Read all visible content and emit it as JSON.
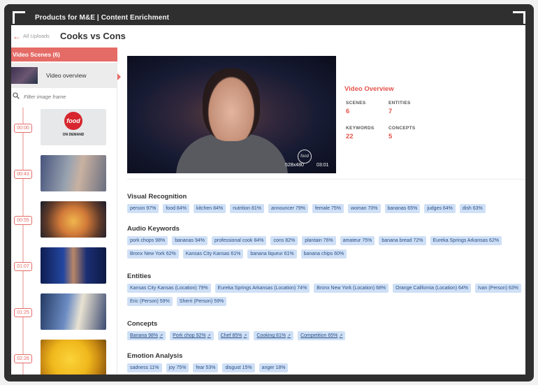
{
  "app": {
    "title": "Products for M&E | Content Enrichment"
  },
  "header": {
    "back_label": "All Uploads",
    "title": "Cooks vs Cons"
  },
  "sidebar": {
    "scenes_label": "Video Scenes (6)",
    "overview_label": "Video overview",
    "filter_placeholder": "Filter image frame",
    "scenes": [
      {
        "time": "00:00",
        "logo_text": "food",
        "logo_sub": "ON DEMAND"
      },
      {
        "time": "00:43"
      },
      {
        "time": "00:55"
      },
      {
        "time": "01:07"
      },
      {
        "time": "01:25"
      },
      {
        "time": "02:26"
      }
    ]
  },
  "video": {
    "logo_text": "food",
    "resolution": "528x480",
    "duration": "03:01"
  },
  "overview": {
    "title": "Video Overview",
    "stats": [
      {
        "label": "SCENES",
        "value": "6"
      },
      {
        "label": "ENTITIES",
        "value": "7"
      },
      {
        "label": "KEYWORDS",
        "value": "22"
      },
      {
        "label": "CONCEPTS",
        "value": "5"
      }
    ]
  },
  "sections": {
    "visual": {
      "title": "Visual Recognition",
      "tags": [
        "person 97%",
        "food 84%",
        "kitchen 84%",
        "nutrition 81%",
        "announcer 79%",
        "female 75%",
        "woman 70%",
        "bananas 65%",
        "judges 64%",
        "dish 63%"
      ]
    },
    "audio": {
      "title": "Audio Keywords",
      "tags": [
        "pork chops 98%",
        "bananas 94%",
        "professional cook 84%",
        "cons 82%",
        "plantain 76%",
        "amateur 75%",
        "banana bread 72%",
        "Eureka Springs Arkansas 62%",
        "Bronx New York 62%",
        "Kansas City Kansas 61%",
        "banana liqueur 61%",
        "banana chips 60%"
      ]
    },
    "entities": {
      "title": "Entities",
      "tags": [
        "Kansas City Kansas (Location) 79%",
        "Eureka Springs Arkansas (Location) 74%",
        "Bronx New York (Location) 68%",
        "Orange California (Location) 64%",
        "Ivan (Person) 63%",
        "Eric (Person) 59%",
        "Sherri (Person) 59%"
      ]
    },
    "concepts": {
      "title": "Concepts",
      "tags": [
        "Banana 98%",
        "Pork chop 92%",
        "Chef 85%",
        "Cooking 81%",
        "Competition 65%"
      ]
    },
    "emotion": {
      "title": "Emotion Analysis",
      "tags": [
        "sadness 11%",
        "joy 75%",
        "fear 53%",
        "disgust 15%",
        "anger 18%"
      ]
    }
  },
  "colors": {
    "accent": "#e5534b",
    "tag_bg": "#cfe0f6",
    "tag_text": "#2a4f86"
  }
}
